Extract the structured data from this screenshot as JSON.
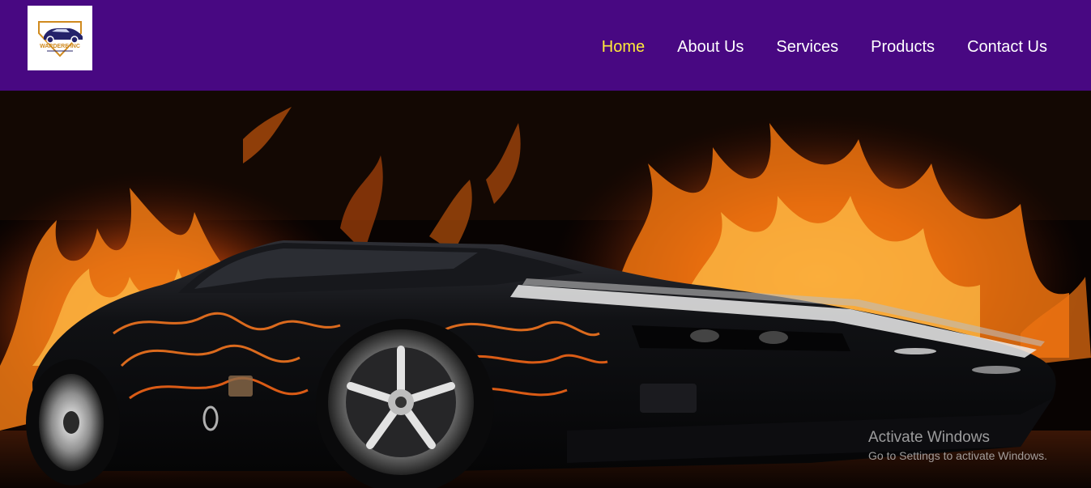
{
  "brand": {
    "logo_text": "WARDERE INC"
  },
  "nav": {
    "items": [
      {
        "label": "Home",
        "active": true
      },
      {
        "label": "About Us",
        "active": false
      },
      {
        "label": "Services",
        "active": false
      },
      {
        "label": "Products",
        "active": false
      },
      {
        "label": "Contact Us",
        "active": false
      }
    ]
  },
  "hero": {
    "image_icon": "car-in-flames-image"
  },
  "watermark": {
    "title": "Activate Windows",
    "subtitle": "Go to Settings to activate Windows."
  },
  "colors": {
    "navbar_bg": "#480882",
    "nav_text": "#ffffff",
    "nav_active": "#ffea3a"
  }
}
